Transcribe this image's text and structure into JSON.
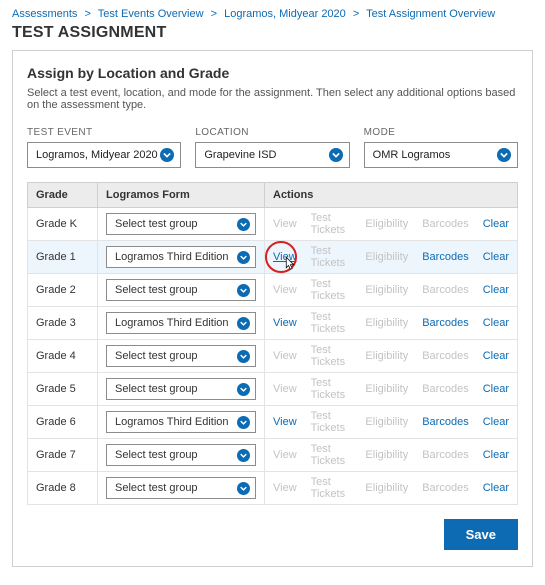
{
  "breadcrumb": {
    "items": [
      {
        "label": "Assessments"
      },
      {
        "label": "Test Events Overview"
      },
      {
        "label": "Logramos, Midyear 2020"
      },
      {
        "label": "Test Assignment Overview"
      }
    ],
    "sep": ">"
  },
  "page_title": "TEST ASSIGNMENT",
  "panel": {
    "heading": "Assign by Location and Grade",
    "desc": "Select a test event, location, and mode for the assignment. Then select any additional options based on the assessment type."
  },
  "dropdowns": {
    "test_event": {
      "label": "TEST EVENT",
      "value": "Logramos, Midyear 2020"
    },
    "location": {
      "label": "LOCATION",
      "value": "Grapevine ISD"
    },
    "mode": {
      "label": "MODE",
      "value": "OMR Logramos"
    }
  },
  "columns": {
    "grade": "Grade",
    "form": "Logramos Form",
    "actions": "Actions"
  },
  "action_labels": {
    "view": "View",
    "test_tickets": "Test Tickets",
    "eligibility": "Eligibility",
    "barcodes": "Barcodes",
    "clear": "Clear"
  },
  "rows": [
    {
      "grade": "Grade K",
      "form": "Select test group",
      "selected": false,
      "highlight": false,
      "view_click": false
    },
    {
      "grade": "Grade 1",
      "form": "Logramos Third Edition",
      "selected": true,
      "highlight": true,
      "view_click": true
    },
    {
      "grade": "Grade 2",
      "form": "Select test group",
      "selected": false,
      "highlight": false,
      "view_click": false
    },
    {
      "grade": "Grade 3",
      "form": "Logramos Third Edition",
      "selected": true,
      "highlight": false,
      "view_click": false
    },
    {
      "grade": "Grade 4",
      "form": "Select test group",
      "selected": false,
      "highlight": false,
      "view_click": false
    },
    {
      "grade": "Grade 5",
      "form": "Select test group",
      "selected": false,
      "highlight": false,
      "view_click": false
    },
    {
      "grade": "Grade 6",
      "form": "Logramos Third Edition",
      "selected": true,
      "highlight": false,
      "view_click": false
    },
    {
      "grade": "Grade 7",
      "form": "Select test group",
      "selected": false,
      "highlight": false,
      "view_click": false
    },
    {
      "grade": "Grade 8",
      "form": "Select test group",
      "selected": false,
      "highlight": false,
      "view_click": false
    }
  ],
  "save_label": "Save"
}
